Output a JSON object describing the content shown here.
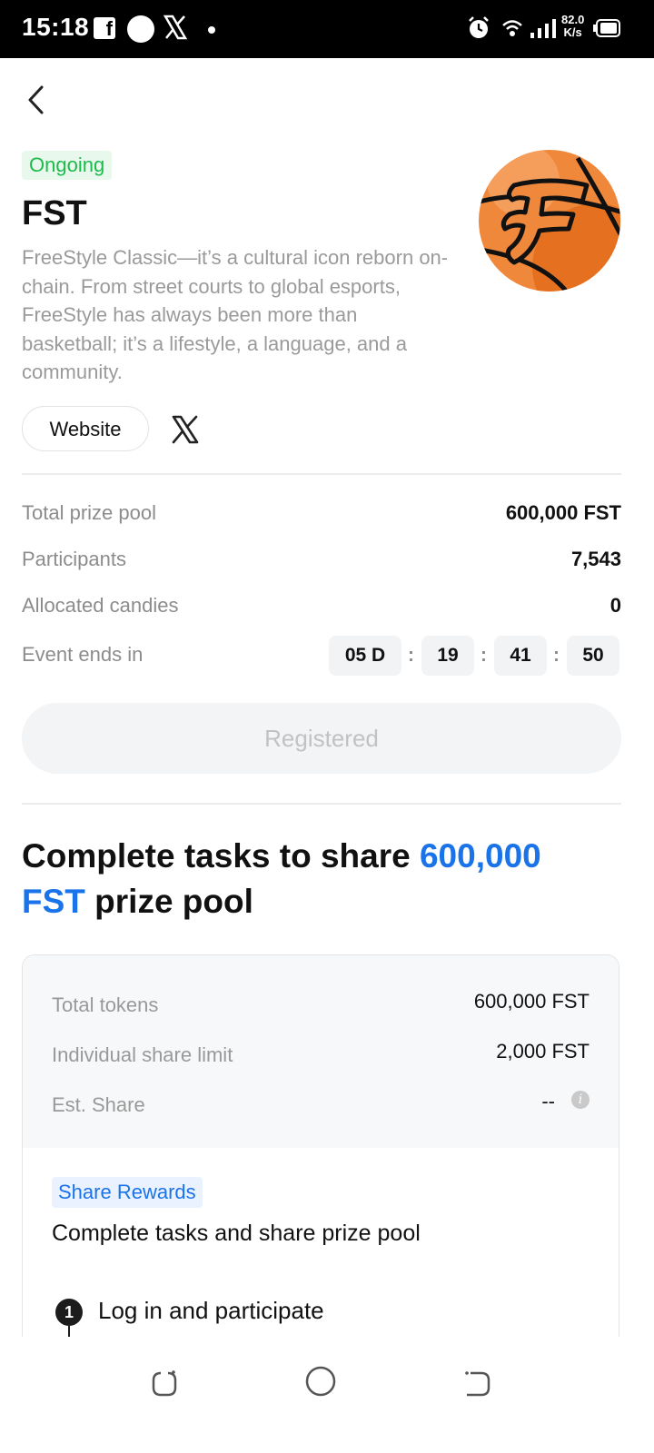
{
  "status_bar": {
    "time": "15:18",
    "fb_glyph": "f",
    "net_speed_value": "82.0",
    "net_speed_unit": "K/s",
    "icons": [
      "facebook-icon",
      "circle-app-icon",
      "x-icon",
      "notification-dot",
      "alarm-icon",
      "wifi-icon",
      "signal-icon",
      "battery-icon"
    ]
  },
  "header": {
    "back_icon": "chevron-left-icon",
    "status_badge": "Ongoing",
    "title": "FST",
    "description": "FreeStyle Classic—it’s a cultural icon reborn on-chain. From street courts to global esports, FreeStyle has always been more than basketball; it’s a lifestyle, a language, and a community.",
    "logo_icon": "fst-basketball-logo",
    "website_label": "Website",
    "x_icon": "x-icon"
  },
  "stats": [
    {
      "label": "Total prize pool",
      "value": "600,000 FST"
    },
    {
      "label": "Participants",
      "value": "7,543"
    },
    {
      "label": "Allocated candies",
      "value": "0"
    }
  ],
  "countdown": {
    "label": "Event ends in",
    "days": "05 D",
    "hours": "19",
    "minutes": "41",
    "seconds": "50",
    "separator": ":"
  },
  "register_button": "Registered",
  "headline": {
    "prefix": "Complete tasks to share ",
    "highlight": "600,000 FST",
    "suffix": " prize pool"
  },
  "pool_card": {
    "rows": [
      {
        "label": "Total tokens",
        "value": "600,000 FST"
      },
      {
        "label": "Individual share limit",
        "value": "2,000 FST"
      },
      {
        "label": "Est. Share",
        "value": "--"
      }
    ],
    "info_glyph": "i",
    "share_badge": "Share Rewards",
    "subtitle": "Complete tasks and share prize pool",
    "step_number": "1",
    "step_label": "Log in and participate"
  },
  "colors": {
    "accent_blue": "#1a73e8",
    "ongoing_green": "#1dbb4c",
    "logo_orange": "#f0883c"
  },
  "nav_bar": {
    "icons": [
      "recent-apps-icon",
      "home-icon",
      "back-icon"
    ]
  }
}
